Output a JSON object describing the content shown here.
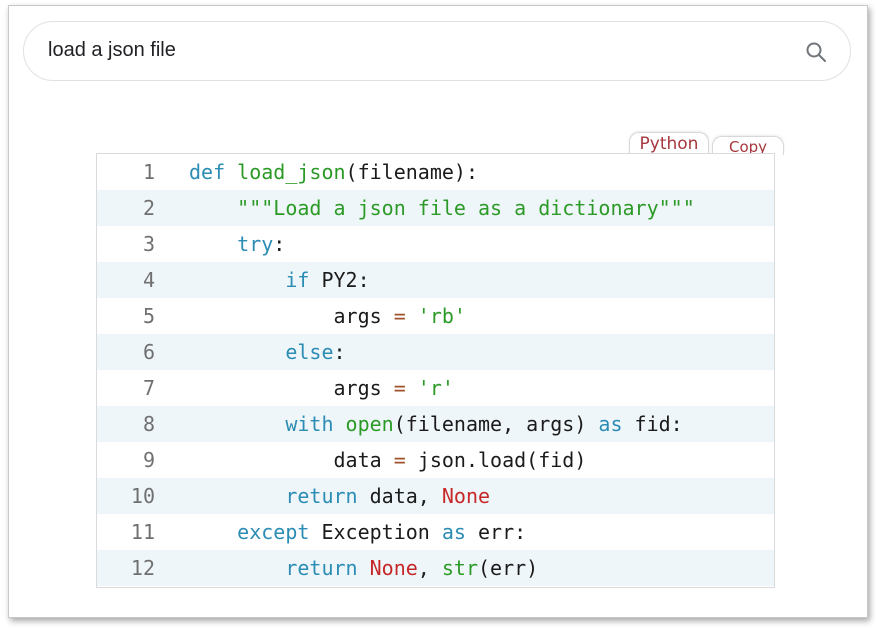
{
  "search": {
    "query": "load a json file"
  },
  "tabs": {
    "python": "Python",
    "copy": "Copy"
  },
  "colors": {
    "keyword": "#2b8cb4",
    "function": "#2b9a26",
    "string": "#2b9a26",
    "operator": "#a0522d",
    "constant": "#c62828",
    "tab_text": "#a5383e",
    "alt_row_bg": "#eff6fa"
  },
  "code": {
    "language": "Python",
    "lines": [
      {
        "num": "1",
        "tokens": [
          {
            "t": "def",
            "c": "kw"
          },
          {
            "t": " ",
            "c": ""
          },
          {
            "t": "load_json",
            "c": "fn"
          },
          {
            "t": "(filename):",
            "c": ""
          }
        ]
      },
      {
        "num": "2",
        "tokens": [
          {
            "t": "    ",
            "c": ""
          },
          {
            "t": "\"\"\"Load a json file as a dictionary\"\"\"",
            "c": "st"
          }
        ]
      },
      {
        "num": "3",
        "tokens": [
          {
            "t": "    ",
            "c": ""
          },
          {
            "t": "try",
            "c": "kw"
          },
          {
            "t": ":",
            "c": ""
          }
        ]
      },
      {
        "num": "4",
        "tokens": [
          {
            "t": "        ",
            "c": ""
          },
          {
            "t": "if",
            "c": "kw"
          },
          {
            "t": " PY2:",
            "c": ""
          }
        ]
      },
      {
        "num": "5",
        "tokens": [
          {
            "t": "            args ",
            "c": ""
          },
          {
            "t": "=",
            "c": "op"
          },
          {
            "t": " ",
            "c": ""
          },
          {
            "t": "'rb'",
            "c": "st"
          }
        ]
      },
      {
        "num": "6",
        "tokens": [
          {
            "t": "        ",
            "c": ""
          },
          {
            "t": "else",
            "c": "kw"
          },
          {
            "t": ":",
            "c": ""
          }
        ]
      },
      {
        "num": "7",
        "tokens": [
          {
            "t": "            args ",
            "c": ""
          },
          {
            "t": "=",
            "c": "op"
          },
          {
            "t": " ",
            "c": ""
          },
          {
            "t": "'r'",
            "c": "st"
          }
        ]
      },
      {
        "num": "8",
        "tokens": [
          {
            "t": "        ",
            "c": ""
          },
          {
            "t": "with",
            "c": "kw"
          },
          {
            "t": " ",
            "c": ""
          },
          {
            "t": "open",
            "c": "fn"
          },
          {
            "t": "(filename, args) ",
            "c": ""
          },
          {
            "t": "as",
            "c": "kw"
          },
          {
            "t": " fid:",
            "c": ""
          }
        ]
      },
      {
        "num": "9",
        "tokens": [
          {
            "t": "            data ",
            "c": ""
          },
          {
            "t": "=",
            "c": "op"
          },
          {
            "t": " json.load(fid)",
            "c": ""
          }
        ]
      },
      {
        "num": "10",
        "tokens": [
          {
            "t": "        ",
            "c": ""
          },
          {
            "t": "return",
            "c": "kw"
          },
          {
            "t": " data, ",
            "c": ""
          },
          {
            "t": "None",
            "c": "cn"
          }
        ]
      },
      {
        "num": "11",
        "tokens": [
          {
            "t": "    ",
            "c": ""
          },
          {
            "t": "except",
            "c": "kw"
          },
          {
            "t": " Exception ",
            "c": ""
          },
          {
            "t": "as",
            "c": "kw"
          },
          {
            "t": " err:",
            "c": ""
          }
        ]
      },
      {
        "num": "12",
        "tokens": [
          {
            "t": "        ",
            "c": ""
          },
          {
            "t": "return",
            "c": "kw"
          },
          {
            "t": " ",
            "c": ""
          },
          {
            "t": "None",
            "c": "cn"
          },
          {
            "t": ", ",
            "c": ""
          },
          {
            "t": "str",
            "c": "fn"
          },
          {
            "t": "(err)",
            "c": ""
          }
        ]
      }
    ]
  }
}
